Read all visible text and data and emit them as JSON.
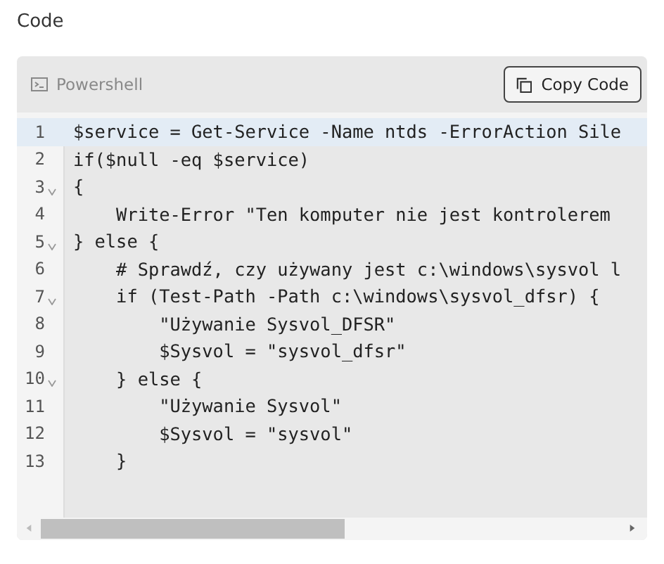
{
  "heading": "Code",
  "code_block": {
    "language": "Powershell",
    "copy_button": "Copy Code",
    "lines": [
      {
        "number": "1",
        "text": "$service = Get-Service -Name ntds -ErrorAction Sile",
        "foldable": false,
        "selected": true
      },
      {
        "number": "2",
        "text": "if($null -eq $service)",
        "foldable": false,
        "selected": false
      },
      {
        "number": "3",
        "text": "{",
        "foldable": true,
        "selected": false
      },
      {
        "number": "4",
        "text": "    Write-Error \"Ten komputer nie jest kontrolerem",
        "foldable": false,
        "selected": false
      },
      {
        "number": "5",
        "text": "} else {",
        "foldable": true,
        "selected": false
      },
      {
        "number": "6",
        "text": "    # Sprawdź, czy używany jest c:\\windows\\sysvol l",
        "foldable": false,
        "selected": false
      },
      {
        "number": "7",
        "text": "    if (Test-Path -Path c:\\windows\\sysvol_dfsr) {",
        "foldable": true,
        "selected": false
      },
      {
        "number": "8",
        "text": "        \"Używanie Sysvol_DFSR\"",
        "foldable": false,
        "selected": false
      },
      {
        "number": "9",
        "text": "        $Sysvol = \"sysvol_dfsr\"",
        "foldable": false,
        "selected": false
      },
      {
        "number": "10",
        "text": "    } else {",
        "foldable": true,
        "selected": false
      },
      {
        "number": "11",
        "text": "        \"Używanie Sysvol\"",
        "foldable": false,
        "selected": false
      },
      {
        "number": "12",
        "text": "        $Sysvol = \"sysvol\"",
        "foldable": false,
        "selected": false
      },
      {
        "number": "13",
        "text": "    }",
        "foldable": false,
        "selected": false
      }
    ]
  }
}
